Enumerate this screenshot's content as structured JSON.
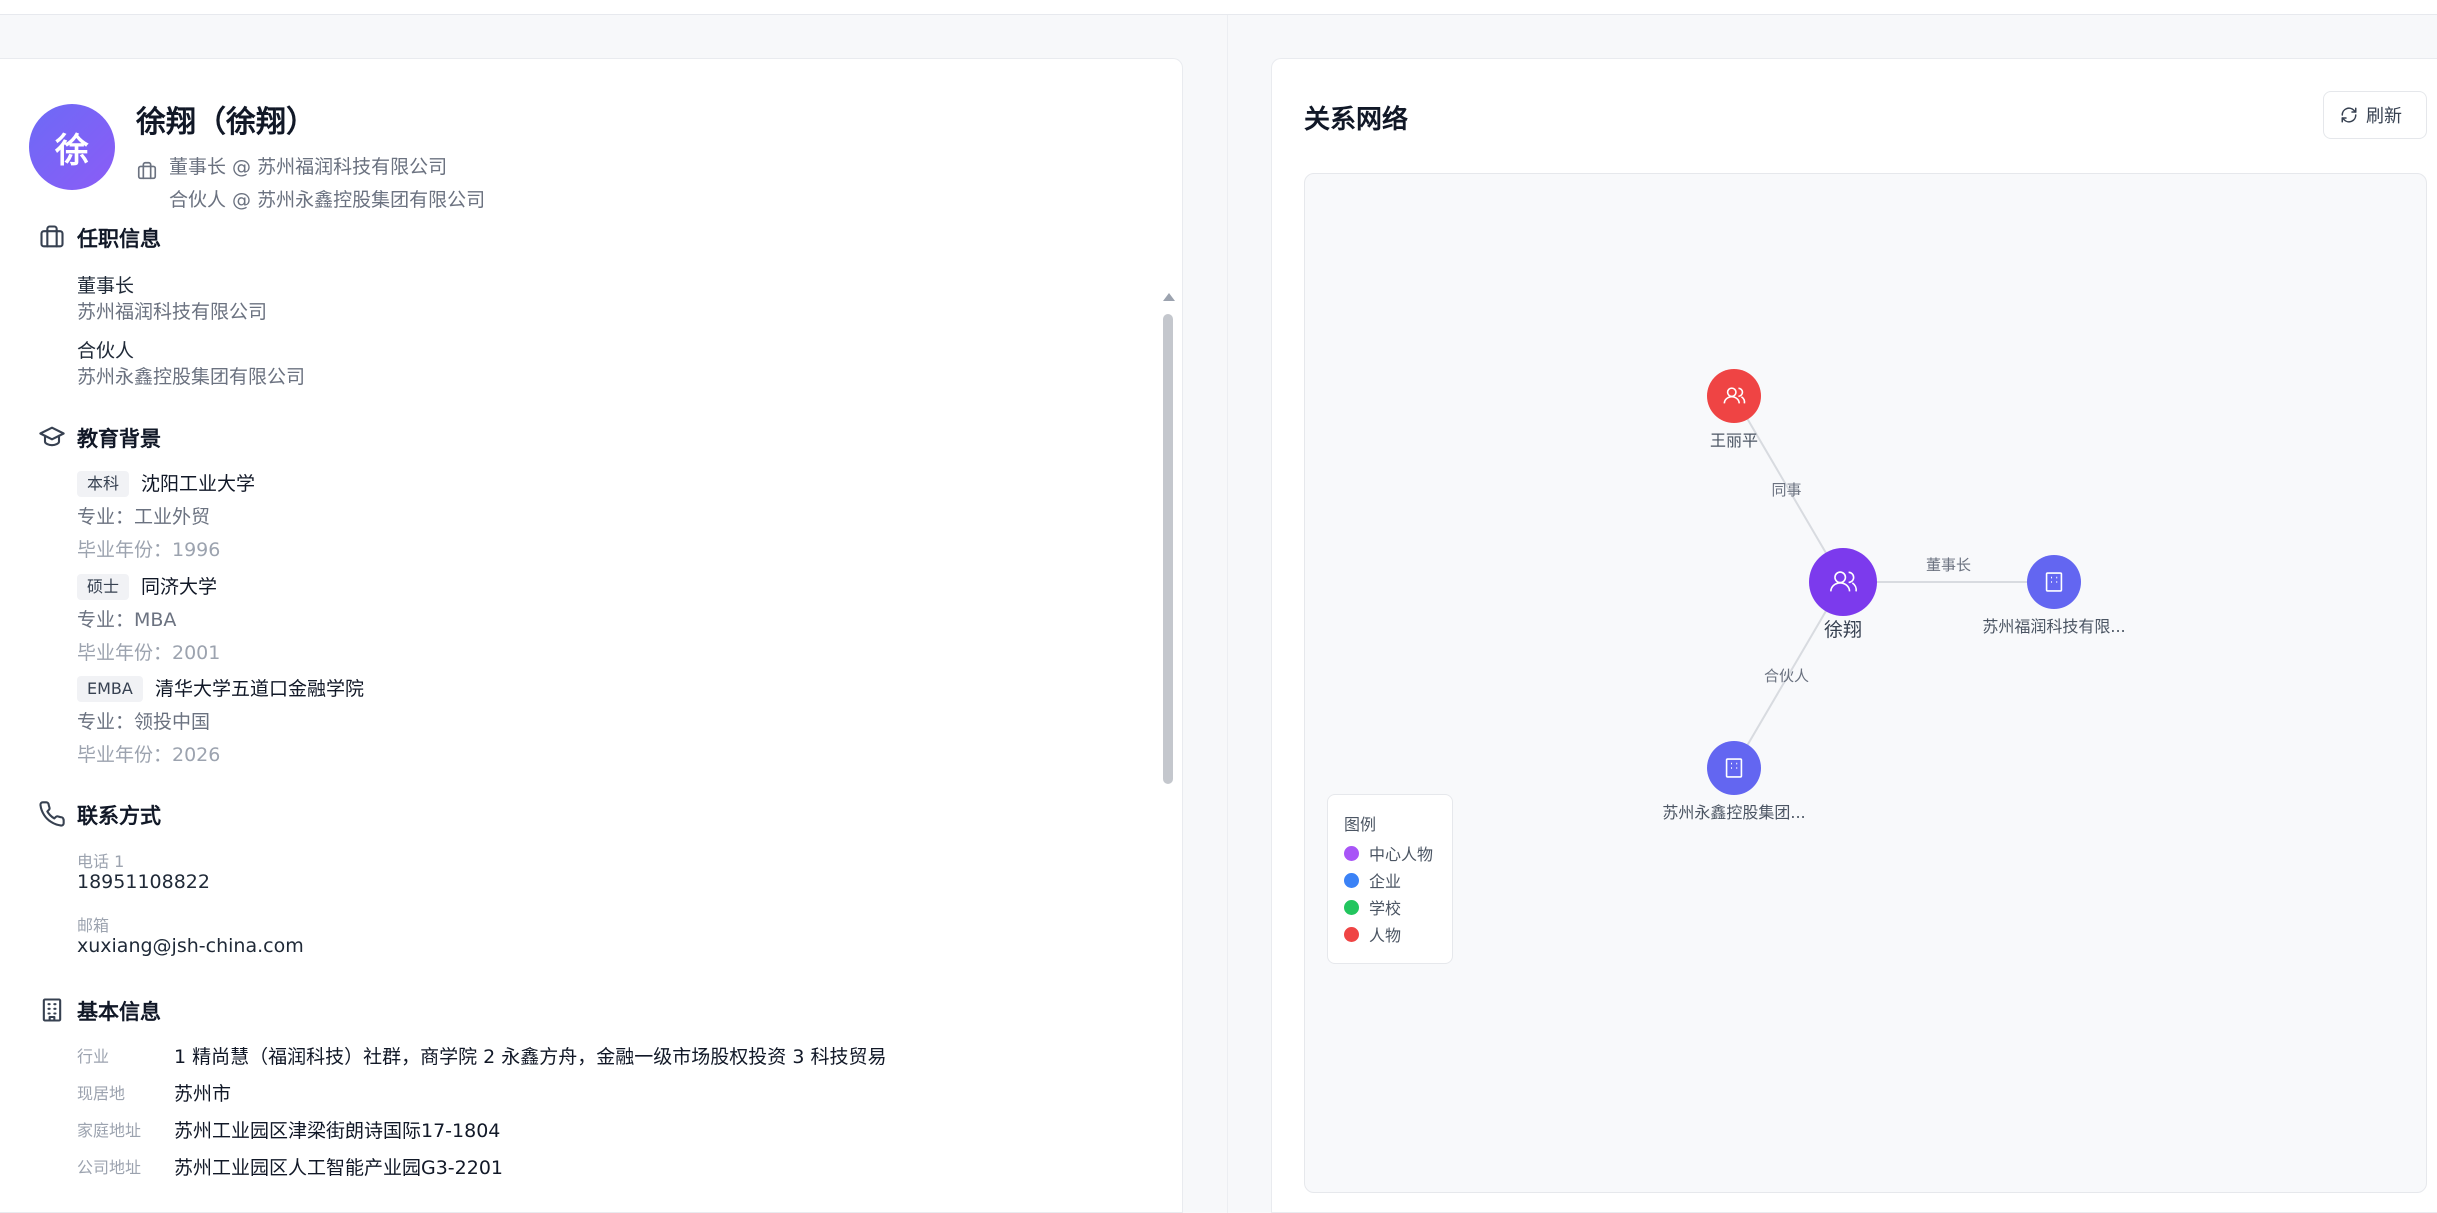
{
  "profile": {
    "avatar_char": "徐",
    "name": "徐翔（徐翔）",
    "positions": [
      "董事长 @ 苏州福润科技有限公司",
      "合伙人 @ 苏州永鑫控股集团有限公司"
    ]
  },
  "employment": {
    "title": "任职信息",
    "items": [
      {
        "role": "董事长",
        "company": "苏州福润科技有限公司"
      },
      {
        "role": "合伙人",
        "company": "苏州永鑫控股集团有限公司"
      }
    ]
  },
  "education": {
    "title": "教育背景",
    "items": [
      {
        "degree": "本科",
        "school": "沈阳工业大学",
        "major": "专业：工业外贸",
        "year": "毕业年份：1996"
      },
      {
        "degree": "硕士",
        "school": "同济大学",
        "major": "专业：MBA",
        "year": "毕业年份：2001"
      },
      {
        "degree": "EMBA",
        "school": "清华大学五道口金融学院",
        "major": "专业：领投中国",
        "year": "毕业年份：2026"
      }
    ]
  },
  "contact": {
    "title": "联系方式",
    "phone_label": "电话 1",
    "phone": "18951108822",
    "email_label": "邮箱",
    "email": "xuxiang@jsh-china.com"
  },
  "basic": {
    "title": "基本信息",
    "rows": [
      {
        "key": "行业",
        "value": "1 精尚慧（福润科技）社群，商学院 2 永鑫方舟，金融一级市场股权投资 3 科技贸易"
      },
      {
        "key": "现居地",
        "value": "苏州市"
      },
      {
        "key": "家庭地址",
        "value": "苏州工业园区津梁街朗诗国际17-1804"
      },
      {
        "key": "公司地址",
        "value": "苏州工业园区人工智能产业园G3-2201"
      }
    ]
  },
  "network": {
    "title": "关系网络",
    "refresh_label": "刷新",
    "nodes": [
      {
        "name": "center",
        "label": "徐翔",
        "type": "center"
      },
      {
        "name": "wanglp",
        "label": "王丽平",
        "type": "person"
      },
      {
        "name": "furun",
        "label": "苏州福润科技有限...",
        "type": "company"
      },
      {
        "name": "yongxin",
        "label": "苏州永鑫控股集团...",
        "type": "company"
      }
    ],
    "edges": [
      {
        "from": "center",
        "to": "wanglp",
        "label": "同事"
      },
      {
        "from": "center",
        "to": "furun",
        "label": "董事长"
      },
      {
        "from": "center",
        "to": "yongxin",
        "label": "合伙人"
      }
    ],
    "legend": {
      "title": "图例",
      "items": [
        {
          "label": "中心人物",
          "color": "#a855f7"
        },
        {
          "label": "企业",
          "color": "#3b82f6"
        },
        {
          "label": "学校",
          "color": "#22c55e"
        },
        {
          "label": "人物",
          "color": "#ef4444"
        }
      ]
    },
    "colors": {
      "center": "#7c3aed",
      "person": "#ef4444",
      "company": "#6366f1"
    }
  }
}
